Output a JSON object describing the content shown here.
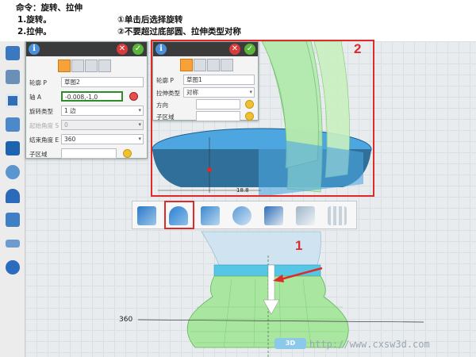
{
  "instructions": {
    "command": "命令：旋转、拉伸",
    "step1": "1.旋转。",
    "step2": "2.拉伸。",
    "note1": "①单击后选择旋转",
    "note2": "②不要超过底部圆、拉伸类型对称"
  },
  "revolve_panel": {
    "profile_label": "轮廓 P",
    "profile_value": "草图2",
    "axis_label": "轴 A",
    "axis_value": "-0.008,-1,0",
    "type_label": "旋转类型",
    "type_value": "1 边",
    "start_label": "起始角度 S",
    "start_value": "0",
    "end_label": "结束角度 E",
    "end_value": "360",
    "sub_label": "子区域"
  },
  "extrude_panel": {
    "profile_label": "轮廓 P",
    "profile_value": "草图1",
    "type_label": "拉伸类型",
    "type_value": "对称",
    "dir_label": "方向",
    "sub_label": "子区域"
  },
  "viewport": {
    "dim_value": "360",
    "small_dim": "18.8",
    "watermark": "http://www.cxsw3d.com",
    "watermark_logo": "3D"
  },
  "callouts": {
    "one": "1",
    "two": "2"
  },
  "colors": {
    "accent_red": "#e02a2a",
    "model_green": "#9be28a",
    "model_blue": "#5aa9d6",
    "active_tab": "#f6a13a"
  },
  "icons": {
    "toolbar": [
      "extrude-icon",
      "revolve-icon",
      "sweep-icon",
      "loft-icon",
      "shell-icon",
      "fillet-icon",
      "pattern-icon"
    ],
    "left": [
      "sketch-icon",
      "pencil-icon",
      "rectangle-icon",
      "stamp-icon",
      "cube-icon",
      "move-icon",
      "magnet-icon",
      "surface-icon",
      "ruler-icon",
      "sphere-icon"
    ]
  }
}
